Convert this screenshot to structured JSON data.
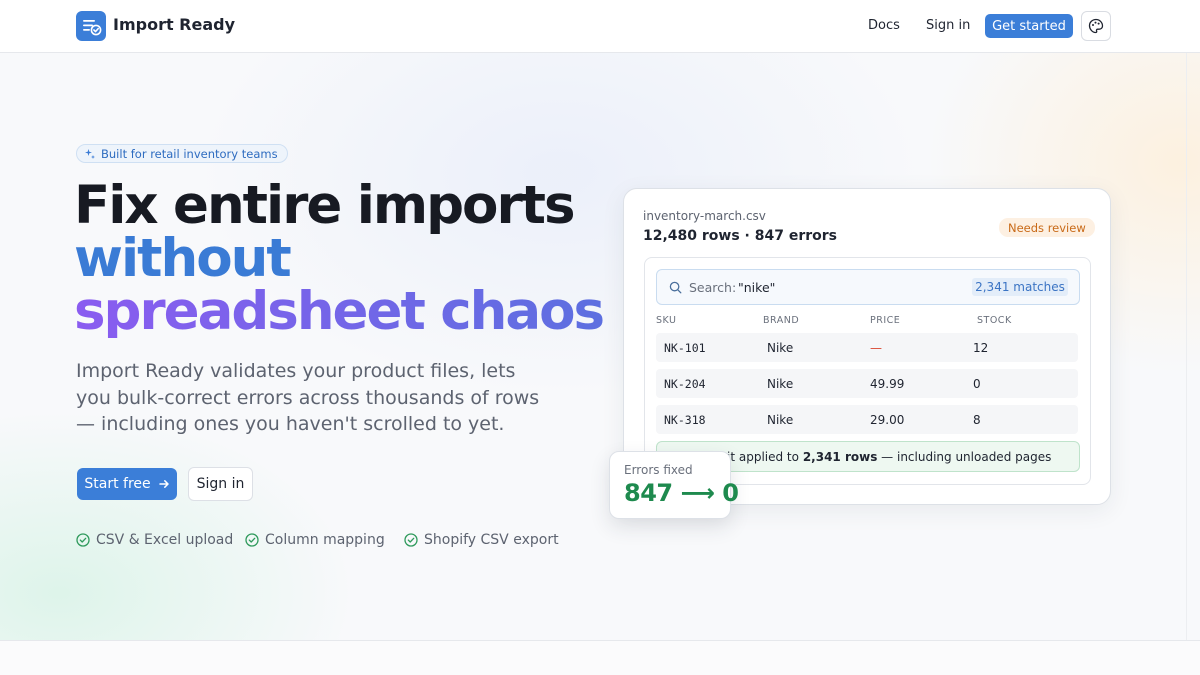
{
  "header": {
    "brand": "Import Ready",
    "nav": {
      "docs": "Docs",
      "sign_in": "Sign in",
      "cta": "Get started"
    },
    "icons": {
      "logo": "list-check-icon",
      "theme": "palette-icon"
    }
  },
  "hero": {
    "badge": "Built for retail inventory teams",
    "headline": [
      "Fix entire imports",
      "without",
      "spreadsheet chaos"
    ],
    "lede": "Import Ready validates your product files, lets you bulk-correct errors across thousands of rows — including ones you haven't scrolled to yet.",
    "primary_cta": "Start free",
    "secondary_cta": "Sign in",
    "features": [
      "CSV & Excel upload",
      "Column mapping",
      "Shopify CSV export"
    ]
  },
  "preview": {
    "file_name": "inventory-march.csv",
    "stats": "12,480 rows · 847 errors",
    "status_badge": "Needs review",
    "search": {
      "label": "Search:",
      "value": "\"nike\"",
      "matches": "2,341 matches"
    },
    "columns": [
      "SKU",
      "BRAND",
      "PRICE",
      "STOCK"
    ],
    "rows": [
      {
        "sku": "NK-101",
        "brand": "Nike",
        "price": "—",
        "stock": "12"
      },
      {
        "sku": "NK-204",
        "brand": "Nike",
        "price": "49.99",
        "stock": "0"
      },
      {
        "sku": "NK-318",
        "brand": "Nike",
        "price": "29.00",
        "stock": "8"
      }
    ],
    "toast": {
      "prefix": "it applied to",
      "count": "2,341 rows",
      "suffix": "— including unloaded pages"
    },
    "errors_fixed": {
      "label": "Errors fixed",
      "value": "847 ⟶ 0"
    }
  },
  "colors": {
    "accent": "#3b7ed8",
    "headline_gradient": [
      "#8a5cf0",
      "#5d6fe0"
    ],
    "success": "#1e8a4e",
    "warning": "#c96a18",
    "error": "#d9442e"
  }
}
